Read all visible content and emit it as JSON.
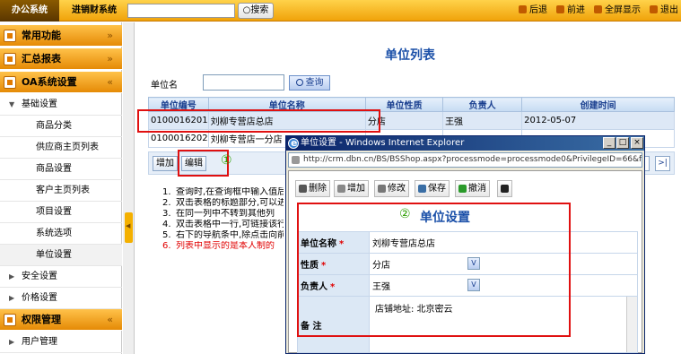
{
  "topbar": {
    "active_tab": "办公系统",
    "other_tab": "进销财系统",
    "search_value": "",
    "search_button": "搜索",
    "nav": [
      "后退",
      "前进",
      "全屏显示",
      "退出"
    ]
  },
  "sidebar": {
    "sections": [
      {
        "label": "常用功能",
        "chevron": "»"
      },
      {
        "label": "汇总报表",
        "chevron": "»"
      },
      {
        "label": "OA系统设置",
        "chevron": "«"
      },
      {
        "label": "权限管理",
        "chevron": "«"
      }
    ],
    "group_basic": "基础设置",
    "basic_items": [
      "商品分类",
      "供应商主页列表",
      "商品设置",
      "客户主页列表",
      "项目设置",
      "系统选项",
      "单位设置"
    ],
    "group_security": "安全设置",
    "group_price": "价格设置",
    "group_user": "用户管理"
  },
  "main": {
    "title": "单位列表",
    "filter_label": "单位名",
    "filter_value": "",
    "query_button": "查询",
    "table": {
      "headers": [
        "单位编号",
        "单位名称",
        "单位性质",
        "负责人",
        "创建时间"
      ],
      "rows": [
        [
          "0100016201",
          "刘柳专营店总店",
          "分店",
          "王强",
          "2012-05-07"
        ],
        [
          "0100016202",
          "刘柳专营店一分店",
          "",
          "",
          ""
        ]
      ]
    },
    "buttons": {
      "add": "增加",
      "edit": "编辑"
    },
    "pager": {
      "next": ">",
      "last": ">|"
    },
    "notes": [
      {
        "n": "1.",
        "text": "查询时,在查询框中输入值后"
      },
      {
        "n": "2.",
        "text": "双击表格的标题部分,可以进"
      },
      {
        "n": "3.",
        "text": "在同一列中不转到其他列"
      },
      {
        "n": "4.",
        "text": "双击表格中一行,可链接该行"
      },
      {
        "n": "5.",
        "text": "右下的导航条中,除点击向前"
      },
      {
        "n": "6.",
        "text": "列表中显示的是本人制的"
      }
    ],
    "annotation_1": "①"
  },
  "popup": {
    "title": "单位设置 - Windows Internet Explorer",
    "address": "http://crm.dbn.cn/BS/BSShop.aspx?processmode=processmode0&PrivilegeID=66&f=kmJ2",
    "toolbar": [
      "删除",
      "增加",
      "修改",
      "保存",
      "撤消"
    ],
    "annotation_2": "②",
    "heading": "单位设置",
    "form": {
      "name_label": "单位名称",
      "name_value": "刘柳专营店总店",
      "nature_label": "性质",
      "nature_value": "分店",
      "owner_label": "负责人",
      "owner_value": "王强",
      "remark_label": "备 注",
      "remark_value": "店铺地址: 北京密云",
      "required_mark": "*"
    }
  },
  "colors": {
    "accent_orange": "#f0a30a",
    "title_blue": "#1a4fa8",
    "annotation_red": "#e01010",
    "annotation_green": "#2ca000"
  }
}
